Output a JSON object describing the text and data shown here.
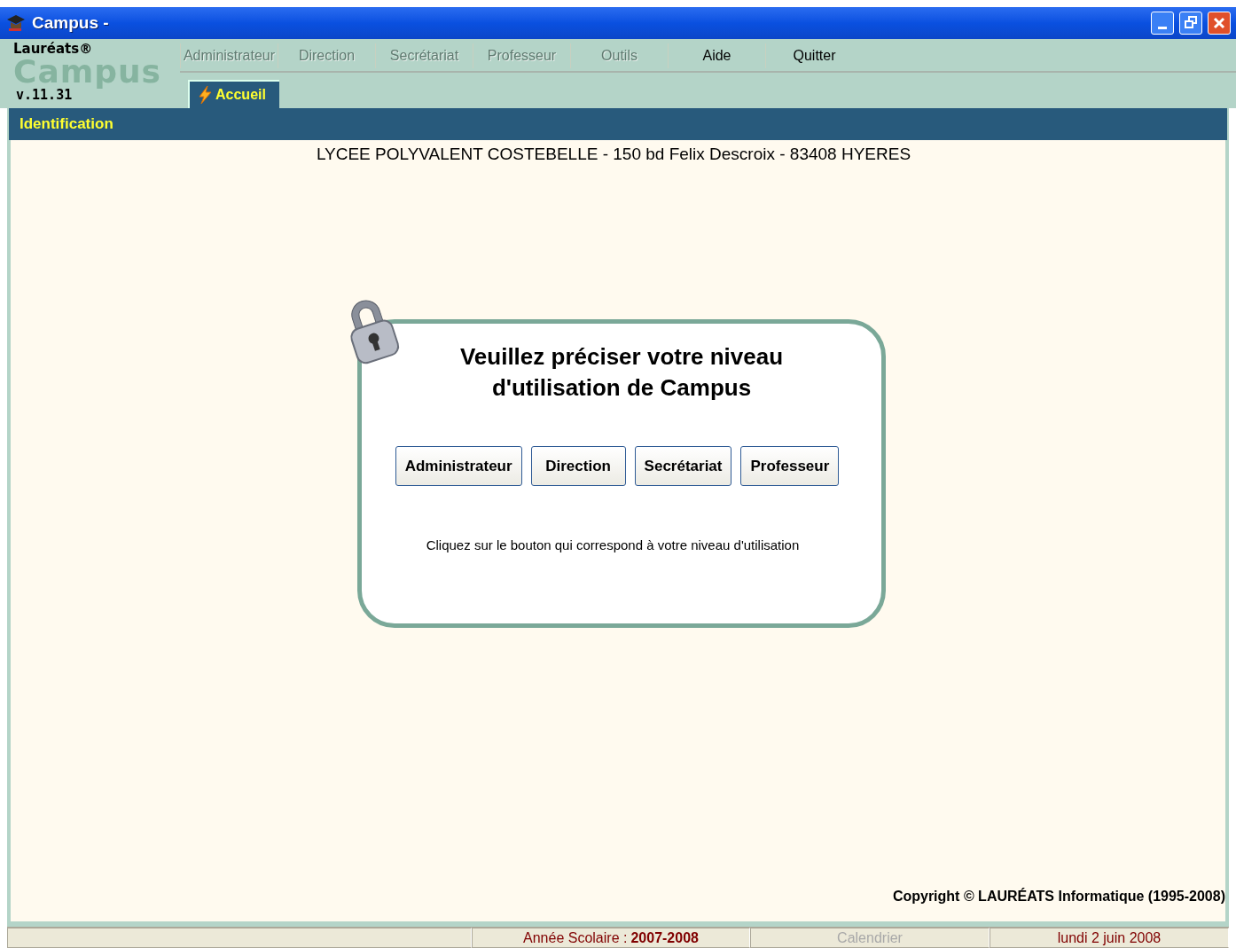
{
  "window": {
    "title": "Campus -"
  },
  "logo": {
    "brand": "Lauréats®",
    "product": "Campus",
    "version": "v.11.31"
  },
  "menu": [
    {
      "label": "Administrateur",
      "disabled": true
    },
    {
      "label": "Direction",
      "disabled": true
    },
    {
      "label": "Secrétariat",
      "disabled": true
    },
    {
      "label": "Professeur",
      "disabled": true
    },
    {
      "label": "Outils",
      "disabled": true
    },
    {
      "label": "Aide",
      "disabled": false
    },
    {
      "label": "Quitter",
      "disabled": false
    }
  ],
  "tabs": [
    {
      "label": "Accueil",
      "selected": true
    }
  ],
  "section_title": "Identification",
  "school": "LYCEE POLYVALENT COSTEBELLE - 150 bd Felix Descroix - 83408 HYERES",
  "dialog": {
    "heading": "Veuillez préciser votre niveau d'utilisation de Campus",
    "buttons": [
      "Administrateur",
      "Direction",
      "Secrétariat",
      "Professeur"
    ],
    "hint": "Cliquez sur le bouton qui correspond à votre niveau d'utilisation"
  },
  "copyright": "Copyright © LAURÉATS Informatique (1995-2008)",
  "status_bar": [
    {
      "label": "Année Scolaire :",
      "value": "2007-2008",
      "disabled": false
    },
    {
      "label": "Calendrier",
      "disabled": true
    },
    {
      "label": "lundi 2 juin 2008",
      "disabled": false
    }
  ]
}
